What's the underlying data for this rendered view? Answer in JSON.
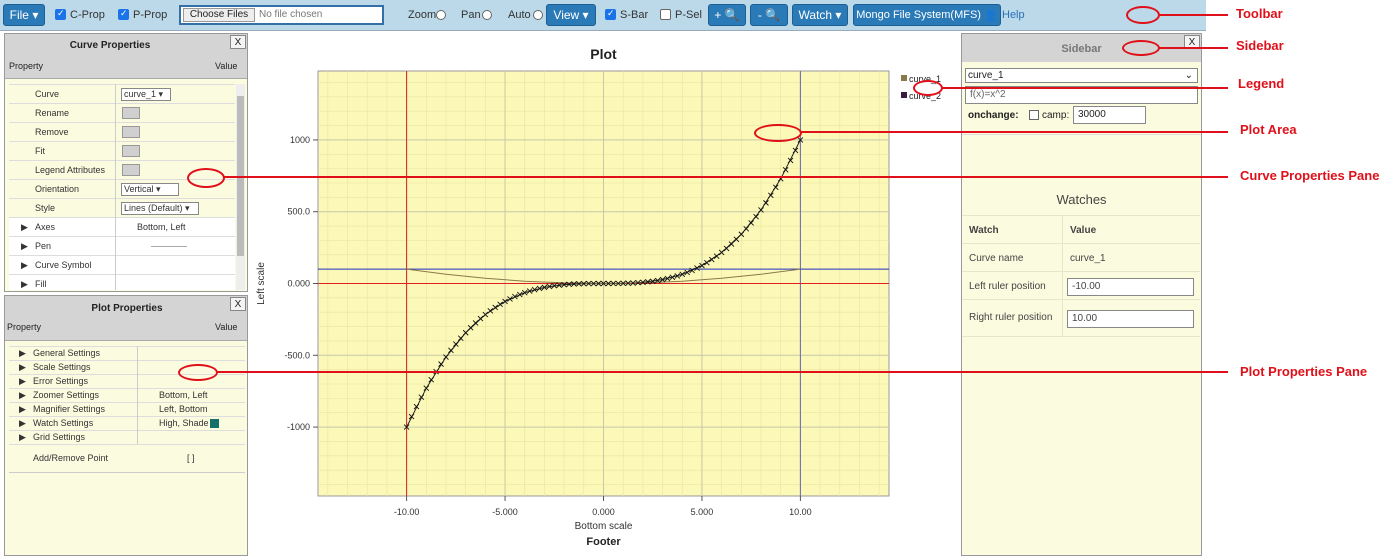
{
  "toolbar": {
    "file": "File",
    "cprop": "C-Prop",
    "pprop": "P-Prop",
    "choose_files": "Choose Files",
    "no_file": "No file chosen",
    "zoom": "Zoom",
    "pan": "Pan",
    "auto": "Auto",
    "view": "View",
    "sbar": "S-Bar",
    "psel": "P-Sel",
    "zoom_in": "+",
    "zoom_out": "-",
    "watch": "Watch",
    "mfs": "Mongo File System(MFS)",
    "help": "Help"
  },
  "curve_pane": {
    "title": "Curve Properties",
    "close": "X",
    "col_property": "Property",
    "col_value": "Value",
    "rows": [
      {
        "label": "Curve",
        "value": "curve_1"
      },
      {
        "label": "Rename",
        "value": ""
      },
      {
        "label": "Remove",
        "value": ""
      },
      {
        "label": "Fit",
        "value": ""
      },
      {
        "label": "Legend Attributes",
        "value": ""
      },
      {
        "label": "Orientation",
        "value": "Vertical"
      },
      {
        "label": "Style",
        "value": "Lines (Default)"
      },
      {
        "label": "Axes",
        "value": "Bottom, Left"
      },
      {
        "label": "Pen",
        "value": ""
      },
      {
        "label": "Curve Symbol",
        "value": ""
      },
      {
        "label": "Fill",
        "value": ""
      }
    ]
  },
  "plot_pane": {
    "title": "Plot Properties",
    "close": "X",
    "col_property": "Property",
    "col_value": "Value",
    "rows": [
      {
        "label": "General Settings",
        "value": ""
      },
      {
        "label": "Scale Settings",
        "value": ""
      },
      {
        "label": "Error Settings",
        "value": ""
      },
      {
        "label": "Zoomer Settings",
        "value": "Bottom, Left"
      },
      {
        "label": "Magnifier Settings",
        "value": "Left, Bottom"
      },
      {
        "label": "Watch Settings",
        "value": "High, Shade"
      },
      {
        "label": "Grid Settings",
        "value": ""
      },
      {
        "label": "Add/Remove Point",
        "value": "[ ]"
      }
    ]
  },
  "plot": {
    "title": "Plot",
    "xlabel": "Bottom scale",
    "ylabel": "Left scale",
    "footer": "Footer",
    "legend": [
      "curve_1",
      "curve_2"
    ]
  },
  "chart_data": {
    "type": "line",
    "title": "Plot",
    "xlabel": "Bottom scale",
    "ylabel": "Left scale",
    "xlim": [
      -14.5,
      14.5
    ],
    "ylim": [
      -1480,
      1480
    ],
    "x_ticks": [
      "-10.00",
      "-5.000",
      "0.000",
      "5.000",
      "10.00"
    ],
    "y_ticks": [
      "1000",
      "500.0",
      "0.000",
      "-500.0",
      "-1000"
    ],
    "series": [
      {
        "name": "curve_1",
        "color": "#222222",
        "function": "x^3",
        "x": [
          -10,
          -9,
          -8,
          -7,
          -6,
          -5,
          -4,
          -3,
          -2,
          -1,
          0,
          1,
          2,
          3,
          4,
          5,
          6,
          7,
          8,
          9,
          10
        ],
        "y": [
          -1000,
          -729,
          -512,
          -343,
          -216,
          -125,
          -64,
          -27,
          -8,
          -1,
          0,
          1,
          8,
          27,
          64,
          125,
          216,
          343,
          512,
          729,
          1000
        ]
      },
      {
        "name": "curve_2",
        "color": "#8a7a4a",
        "function": "f(x)=x^2",
        "x": [
          -10,
          -8,
          -6,
          -4,
          -2,
          0,
          2,
          4,
          6,
          8,
          10
        ],
        "y": [
          100,
          64,
          36,
          16,
          4,
          0,
          4,
          16,
          36,
          64,
          100
        ]
      }
    ],
    "markers": {
      "vertical": [
        -10,
        10
      ],
      "horizontal": [
        100,
        0
      ]
    },
    "grid": true,
    "legend_position": "top-right outside"
  },
  "sidebar": {
    "title": "Sidebar",
    "close": "X",
    "curve_select": "curve_1",
    "function_text": "f(x)=x^2",
    "onchange_label": "onchange:",
    "camp_label": "camp:",
    "camp_value": "30000",
    "watches_title": "Watches",
    "watch_header": "Watch",
    "value_header": "Value",
    "watches": [
      {
        "label": "Curve name",
        "value": "curve_1"
      },
      {
        "label": "Left ruler position",
        "value": "-10.00"
      },
      {
        "label": "Right ruler position",
        "value": "10.00"
      }
    ]
  },
  "annotations": {
    "toolbar": "Toolbar",
    "sidebar": "Sidebar",
    "legend": "Legend",
    "plot_area": "Plot Area",
    "curve_pane": "Curve Properties Pane",
    "plot_pane": "Plot Properties Pane"
  },
  "colors": {
    "accent": "#2a7ab8",
    "annotation": "#e0101a",
    "plot_bg": "#fbf8b8"
  }
}
